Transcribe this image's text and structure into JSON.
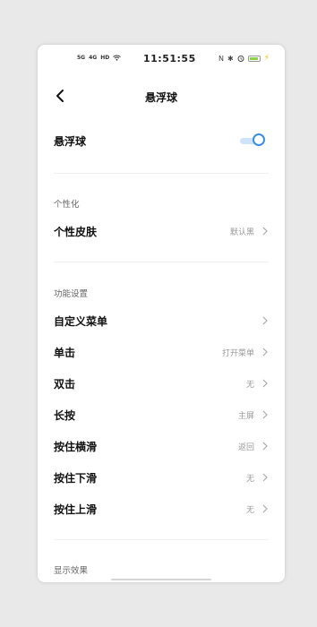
{
  "status_bar": {
    "signal_1": "5G",
    "signal_2": "4G",
    "hd": "HD",
    "clock": "11:51:55",
    "nfc": "N",
    "bluetooth": "✱"
  },
  "header": {
    "title": "悬浮球"
  },
  "main_toggle": {
    "label": "悬浮球",
    "state": "on",
    "accent": "#3b8ee6"
  },
  "personalization": {
    "section_title": "个性化",
    "skin": {
      "label": "个性皮肤",
      "value": "默认黑"
    }
  },
  "function_settings": {
    "section_title": "功能设置",
    "items": [
      {
        "label": "自定义菜单",
        "value": ""
      },
      {
        "label": "单击",
        "value": "打开菜单"
      },
      {
        "label": "双击",
        "value": "无"
      },
      {
        "label": "长按",
        "value": "主屏"
      },
      {
        "label": "按住横滑",
        "value": "返回"
      },
      {
        "label": "按住下滑",
        "value": "无"
      },
      {
        "label": "按住上滑",
        "value": "无"
      }
    ]
  },
  "display_effect": {
    "section_title": "显示效果"
  }
}
